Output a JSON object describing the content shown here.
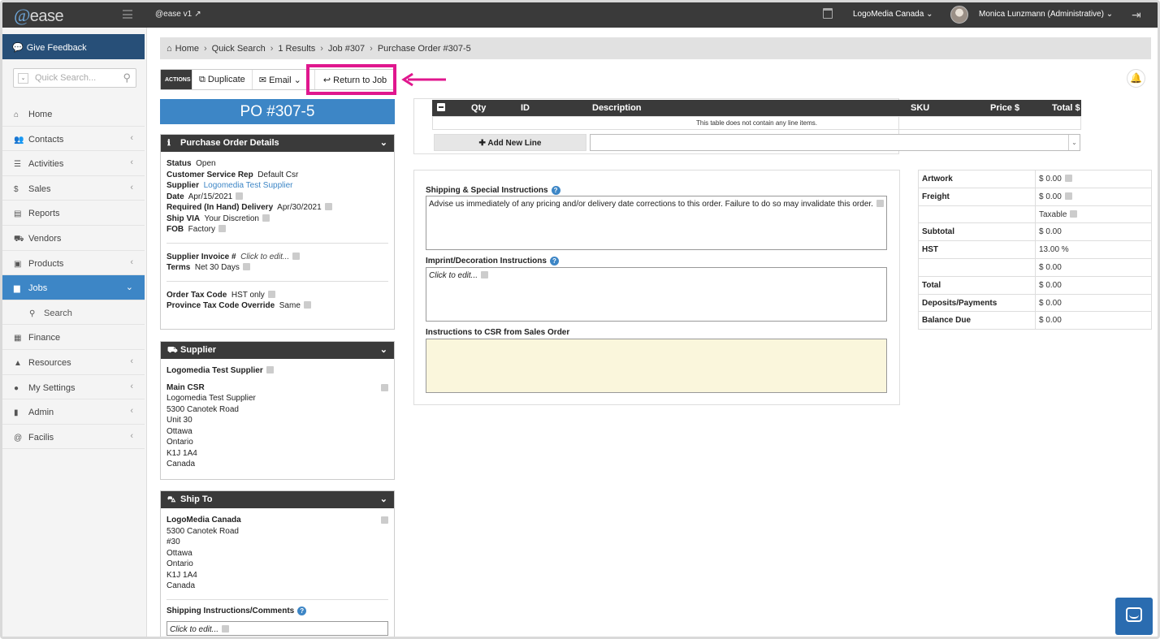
{
  "topbar": {
    "logo_at": "@",
    "logo_text": "ease",
    "version": "@ease v1",
    "company": "LogoMedia Canada",
    "user": "Monica Lunzmann (Administrative)"
  },
  "sidebar": {
    "feedback": "Give Feedback",
    "search_placeholder": "Quick Search...",
    "items": [
      {
        "label": "Home",
        "icon": "home-icon",
        "glyph": "⌂",
        "chev": ""
      },
      {
        "label": "Contacts",
        "icon": "contacts-icon",
        "glyph": "👥",
        "chev": "‹"
      },
      {
        "label": "Activities",
        "icon": "activities-icon",
        "glyph": "☰",
        "chev": "‹"
      },
      {
        "label": "Sales",
        "icon": "dollar-icon",
        "glyph": "$",
        "chev": "‹"
      },
      {
        "label": "Reports",
        "icon": "reports-icon",
        "glyph": "▤",
        "chev": ""
      },
      {
        "label": "Vendors",
        "icon": "truck-icon",
        "glyph": "⛟",
        "chev": ""
      },
      {
        "label": "Products",
        "icon": "gift-icon",
        "glyph": "▣",
        "chev": "‹"
      },
      {
        "label": "Jobs",
        "icon": "folder-icon",
        "glyph": "▆",
        "chev": "⌄"
      },
      {
        "label": "Search",
        "icon": "search-icon",
        "glyph": "⚲",
        "chev": ""
      },
      {
        "label": "Finance",
        "icon": "calculator-icon",
        "glyph": "▦",
        "chev": ""
      },
      {
        "label": "Resources",
        "icon": "graduation-cap-icon",
        "glyph": "▲",
        "chev": "‹"
      },
      {
        "label": "My Settings",
        "icon": "user-icon",
        "glyph": "●",
        "chev": "‹"
      },
      {
        "label": "Admin",
        "icon": "book-icon",
        "glyph": "▮",
        "chev": "‹"
      },
      {
        "label": "Facilis",
        "icon": "at-icon",
        "glyph": "@",
        "chev": "‹"
      }
    ]
  },
  "breadcrumb": [
    "Home",
    "Quick Search",
    "1 Results",
    "Job #307",
    "Purchase Order #307-5"
  ],
  "actions": {
    "label": "ACTIONS",
    "duplicate": "Duplicate",
    "email": "Email",
    "return": "Return to Job"
  },
  "po_title": "PO #307-5",
  "details": {
    "title": "Purchase Order Details",
    "status_k": "Status",
    "status_v": "Open",
    "csr_k": "Customer Service Rep",
    "csr_v": "Default Csr",
    "supplier_k": "Supplier",
    "supplier_v": "Logomedia Test Supplier",
    "date_k": "Date",
    "date_v": "Apr/15/2021",
    "inhand_k": "Required (In Hand) Delivery",
    "inhand_v": "Apr/30/2021",
    "shipvia_k": "Ship VIA",
    "shipvia_v": "Your Discretion",
    "fob_k": "FOB",
    "fob_v": "Factory",
    "inv_k": "Supplier Invoice #",
    "inv_v": "Click to edit...",
    "terms_k": "Terms",
    "terms_v": "Net 30 Days",
    "taxcode_k": "Order Tax Code",
    "taxcode_v": "HST only",
    "prov_k": "Province Tax Code Override",
    "prov_v": "Same"
  },
  "supplier": {
    "title": "Supplier",
    "name": "Logomedia Test Supplier",
    "main_csr": "Main CSR",
    "lines": [
      "Logomedia Test Supplier",
      "5300 Canotek Road",
      "Unit 30",
      "Ottawa",
      "Ontario",
      "K1J 1A4",
      "Canada"
    ]
  },
  "shipto": {
    "title": "Ship To",
    "name": "LogoMedia Canada",
    "lines": [
      "5300 Canotek Road",
      "#30",
      "Ottawa",
      "Ontario",
      "K1J 1A4",
      "Canada"
    ],
    "comments_label": "Shipping Instructions/Comments",
    "comments_value": "Click to edit..."
  },
  "line_items": {
    "cols": [
      "Qty",
      "ID",
      "Description",
      "SKU",
      "Price $",
      "Total $"
    ],
    "empty": "This table does not contain any line items.",
    "add": "Add New Line"
  },
  "instructions": {
    "shipping_label": "Shipping & Special Instructions",
    "shipping_text": "Advise us immediately of any pricing and/or delivery date corrections to this order. Failure to do so may invalidate this order.",
    "imprint_label": "Imprint/Decoration Instructions",
    "imprint_text": "Click to edit...",
    "csr_label": "Instructions to CSR from Sales Order"
  },
  "totals": [
    {
      "k": "Artwork",
      "v": "$ 0.00",
      "edit": true
    },
    {
      "k": "Freight",
      "v": "$ 0.00",
      "edit": true
    },
    {
      "k": "",
      "v": "Taxable",
      "edit": true
    },
    {
      "k": "Subtotal",
      "v": "$ 0.00",
      "edit": false
    },
    {
      "k": "HST",
      "v": "13.00 %",
      "edit": false
    },
    {
      "k": "",
      "v": "$ 0.00",
      "edit": false
    },
    {
      "k": "Total",
      "v": "$ 0.00",
      "edit": false
    },
    {
      "k": "Deposits/Payments",
      "v": "$ 0.00",
      "edit": false
    },
    {
      "k": "Balance Due",
      "v": "$ 0.00",
      "edit": false
    }
  ],
  "colors": {
    "accent": "#3d86c6",
    "dark": "#3a3a3a",
    "highlight": "#e0178e",
    "csr_box": "#faf6dc"
  }
}
